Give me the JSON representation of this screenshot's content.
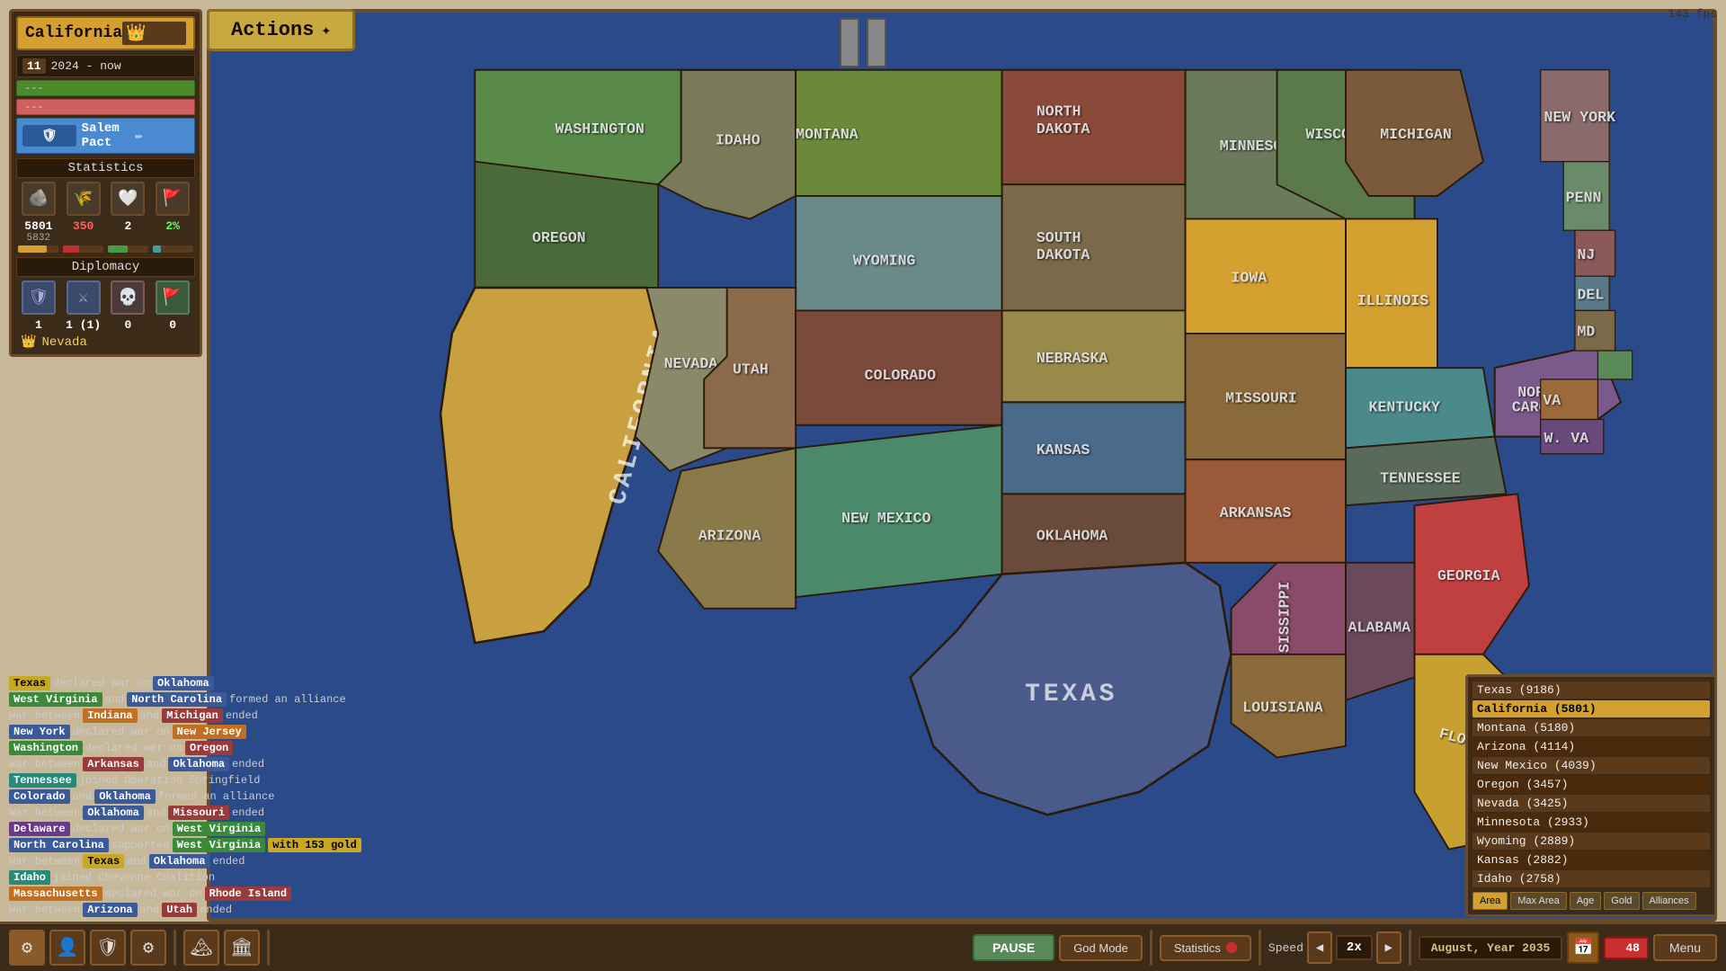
{
  "fps": "143 fps",
  "left_panel": {
    "title": "California",
    "crown": "👑",
    "population_num": "11",
    "year_range": "2024 - now",
    "bar_green_text": "---",
    "bar_pink_text": "---",
    "alliance": "Salem Pact",
    "statistics_label": "Statistics",
    "icons": [
      "🪨",
      "🌾",
      "🤍",
      "🚩"
    ],
    "stat1_val": "5801",
    "stat1_sub": "5832",
    "stat2_val": "350",
    "stat2_sub": "",
    "stat3_val": "2",
    "stat3_sub": "",
    "stat4_val": "2%",
    "stat4_sub": "",
    "diplomacy_label": "Diplomacy",
    "diplo_icons": [
      "🛡",
      "⚔",
      "💀",
      "🚩"
    ],
    "diplo_nums": [
      "1",
      "1 (1)",
      "0",
      "0"
    ],
    "enemy_label": "Nevada",
    "enemy_crown": "👑"
  },
  "actions": {
    "label": "Actions",
    "icon": "✦"
  },
  "map": {
    "states": [
      {
        "name": "MONTANA",
        "color": "#6a8a3a"
      },
      {
        "name": "NORTH DAKOTA",
        "color": "#8a4a3a"
      },
      {
        "name": "MINNESOTA",
        "color": "#6a7a5a"
      },
      {
        "name": "OREGON",
        "color": "#4a6a3a"
      },
      {
        "name": "IDAHO",
        "color": "#7a7a5a"
      },
      {
        "name": "WYOMING",
        "color": "#6a8a8a"
      },
      {
        "name": "SOUTH DAKOTA",
        "color": "#7a6a4a"
      },
      {
        "name": "IOWA",
        "color": "#d4a030"
      },
      {
        "name": "NEBRASKA",
        "color": "#9a8a4a"
      },
      {
        "name": "ILLINOIS",
        "color": "#d4a030"
      },
      {
        "name": "NEVADA",
        "color": "#8a8a6a"
      },
      {
        "name": "UTAH",
        "color": "#8a6a4a"
      },
      {
        "name": "COLORADO",
        "color": "#7a4a3a"
      },
      {
        "name": "KANSAS",
        "color": "#4a6a8a"
      },
      {
        "name": "MISSOURI",
        "color": "#8a6a3a"
      },
      {
        "name": "KENTUCKY",
        "color": "#4a8a8a"
      },
      {
        "name": "CALIFORNIA",
        "color": "#c8a040"
      },
      {
        "name": "ARIZONA",
        "color": "#8a7a4a"
      },
      {
        "name": "NEW MEXICO",
        "color": "#4a8a6a"
      },
      {
        "name": "OKLAHOMA",
        "color": "#6a4a3a"
      },
      {
        "name": "ARKANSAS",
        "color": "#9a5a3a"
      },
      {
        "name": "GEORGIA",
        "color": "#c04040"
      },
      {
        "name": "TEXAS",
        "color": "#4a5a8a"
      },
      {
        "name": "MISSISSIPPI",
        "color": "#8a4a6a"
      },
      {
        "name": "ALABAMA",
        "color": "#6a4a5a"
      },
      {
        "name": "FLORIDA",
        "color": "#c8a030"
      },
      {
        "name": "WASHINGTON",
        "color": "#5a8a4a"
      },
      {
        "name": "MICHIGAN",
        "color": "#7a5a3a"
      },
      {
        "name": "WISCONSIN",
        "color": "#5a7a4a"
      },
      {
        "name": "NORTH CAROLINA",
        "color": "#7a5a8a"
      },
      {
        "name": "TENNESSEE",
        "color": "#5a6a5a"
      },
      {
        "name": "NEW YORK",
        "color": "#8a6a6a"
      }
    ]
  },
  "events": [
    {
      "parts": [
        {
          "text": "Texas",
          "class": "evt-yellow"
        },
        {
          "text": "declared war on",
          "class": "evt-text"
        },
        {
          "text": "Oklahoma",
          "class": "evt-blue"
        }
      ]
    },
    {
      "parts": [
        {
          "text": "West Virginia",
          "class": "evt-green"
        },
        {
          "text": "and",
          "class": "evt-text"
        },
        {
          "text": "North Carolina",
          "class": "evt-blue"
        },
        {
          "text": "formed an alliance",
          "class": "evt-text"
        }
      ]
    },
    {
      "parts": [
        {
          "text": "War between",
          "class": "evt-text"
        },
        {
          "text": "Indiana",
          "class": "evt-orange"
        },
        {
          "text": "and",
          "class": "evt-text"
        },
        {
          "text": "Michigan",
          "class": "evt-red"
        },
        {
          "text": "ended",
          "class": "evt-text"
        }
      ]
    },
    {
      "parts": [
        {
          "text": "New York",
          "class": "evt-blue"
        },
        {
          "text": "declared war on",
          "class": "evt-text"
        },
        {
          "text": "New Jersey",
          "class": "evt-orange"
        }
      ]
    },
    {
      "parts": [
        {
          "text": "Washington",
          "class": "evt-green"
        },
        {
          "text": "declared war on",
          "class": "evt-text"
        },
        {
          "text": "Oregon",
          "class": "evt-red"
        }
      ]
    },
    {
      "parts": [
        {
          "text": "War between",
          "class": "evt-text"
        },
        {
          "text": "Arkansas",
          "class": "evt-red"
        },
        {
          "text": "and",
          "class": "evt-text"
        },
        {
          "text": "Oklahoma",
          "class": "evt-blue"
        },
        {
          "text": "ended",
          "class": "evt-text"
        }
      ]
    },
    {
      "parts": [
        {
          "text": "Tennessee",
          "class": "evt-teal"
        },
        {
          "text": "joined Operation Springfield",
          "class": "evt-text"
        }
      ]
    },
    {
      "parts": [
        {
          "text": "Colorado",
          "class": "evt-blue"
        },
        {
          "text": "and",
          "class": "evt-text"
        },
        {
          "text": "Oklahoma",
          "class": "evt-blue"
        },
        {
          "text": "formed an alliance",
          "class": "evt-text"
        }
      ]
    },
    {
      "parts": [
        {
          "text": "War between",
          "class": "evt-text"
        },
        {
          "text": "Oklahoma",
          "class": "evt-blue"
        },
        {
          "text": "and",
          "class": "evt-text"
        },
        {
          "text": "Missouri",
          "class": "evt-red"
        },
        {
          "text": "ended",
          "class": "evt-text"
        }
      ]
    },
    {
      "parts": [
        {
          "text": "Delaware",
          "class": "evt-purple"
        },
        {
          "text": "declared war on",
          "class": "evt-text"
        },
        {
          "text": "West Virginia",
          "class": "evt-green"
        }
      ]
    },
    {
      "parts": [
        {
          "text": "North Carolina",
          "class": "evt-blue"
        },
        {
          "text": "supported",
          "class": "evt-text"
        },
        {
          "text": "West Virginia",
          "class": "evt-green"
        },
        {
          "text": "with 153 gold",
          "class": "evt-yellow"
        }
      ]
    },
    {
      "parts": [
        {
          "text": "War between",
          "class": "evt-text"
        },
        {
          "text": "Texas",
          "class": "evt-yellow"
        },
        {
          "text": "and",
          "class": "evt-text"
        },
        {
          "text": "Oklahoma",
          "class": "evt-blue"
        },
        {
          "text": "ended",
          "class": "evt-text"
        }
      ]
    },
    {
      "parts": [
        {
          "text": "Idaho",
          "class": "evt-teal"
        },
        {
          "text": "joined Cheyenne Coalition",
          "class": "evt-text"
        }
      ]
    },
    {
      "parts": [
        {
          "text": "Massachusetts",
          "class": "evt-orange"
        },
        {
          "text": "declared war on",
          "class": "evt-text"
        },
        {
          "text": "Rhode Island",
          "class": "evt-red"
        }
      ]
    },
    {
      "parts": [
        {
          "text": "War between",
          "class": "evt-text"
        },
        {
          "text": "Arizona",
          "class": "evt-blue"
        },
        {
          "text": "and",
          "class": "evt-text"
        },
        {
          "text": "Utah",
          "class": "evt-red"
        },
        {
          "text": "ended",
          "class": "evt-text"
        }
      ]
    }
  ],
  "rankings": {
    "items": [
      {
        "label": "Texas (9186)",
        "highlighted": false
      },
      {
        "label": "California (5801)",
        "highlighted": true
      },
      {
        "label": "Montana (5180)",
        "highlighted": false
      },
      {
        "label": "Arizona (4114)",
        "highlighted": false
      },
      {
        "label": "New Mexico (4039)",
        "highlighted": false
      },
      {
        "label": "Oregon (3457)",
        "highlighted": false
      },
      {
        "label": "Nevada (3425)",
        "highlighted": false
      },
      {
        "label": "Minnesota (2933)",
        "highlighted": false
      },
      {
        "label": "Wyoming (2889)",
        "highlighted": false
      },
      {
        "label": "Kansas (2882)",
        "highlighted": false
      },
      {
        "label": "Idaho (2758)",
        "highlighted": false
      }
    ],
    "buttons": [
      {
        "label": "Area",
        "active": true
      },
      {
        "label": "Max Area",
        "active": false
      },
      {
        "label": "Age",
        "active": false
      },
      {
        "label": "Gold",
        "active": false
      },
      {
        "label": "Alliances",
        "active": false
      }
    ]
  },
  "bottom_bar": {
    "pause_label": "PAUSE",
    "god_mode_label": "God Mode",
    "statistics_label": "Statistics",
    "speed_label": "Speed",
    "speed_value": "2x",
    "date_label": "August, Year 2035",
    "notification_count": "48",
    "menu_label": "Menu",
    "bottom_icons": [
      "⚙",
      "👤",
      "🛡",
      "⚙",
      "🏔",
      "🏛"
    ]
  }
}
